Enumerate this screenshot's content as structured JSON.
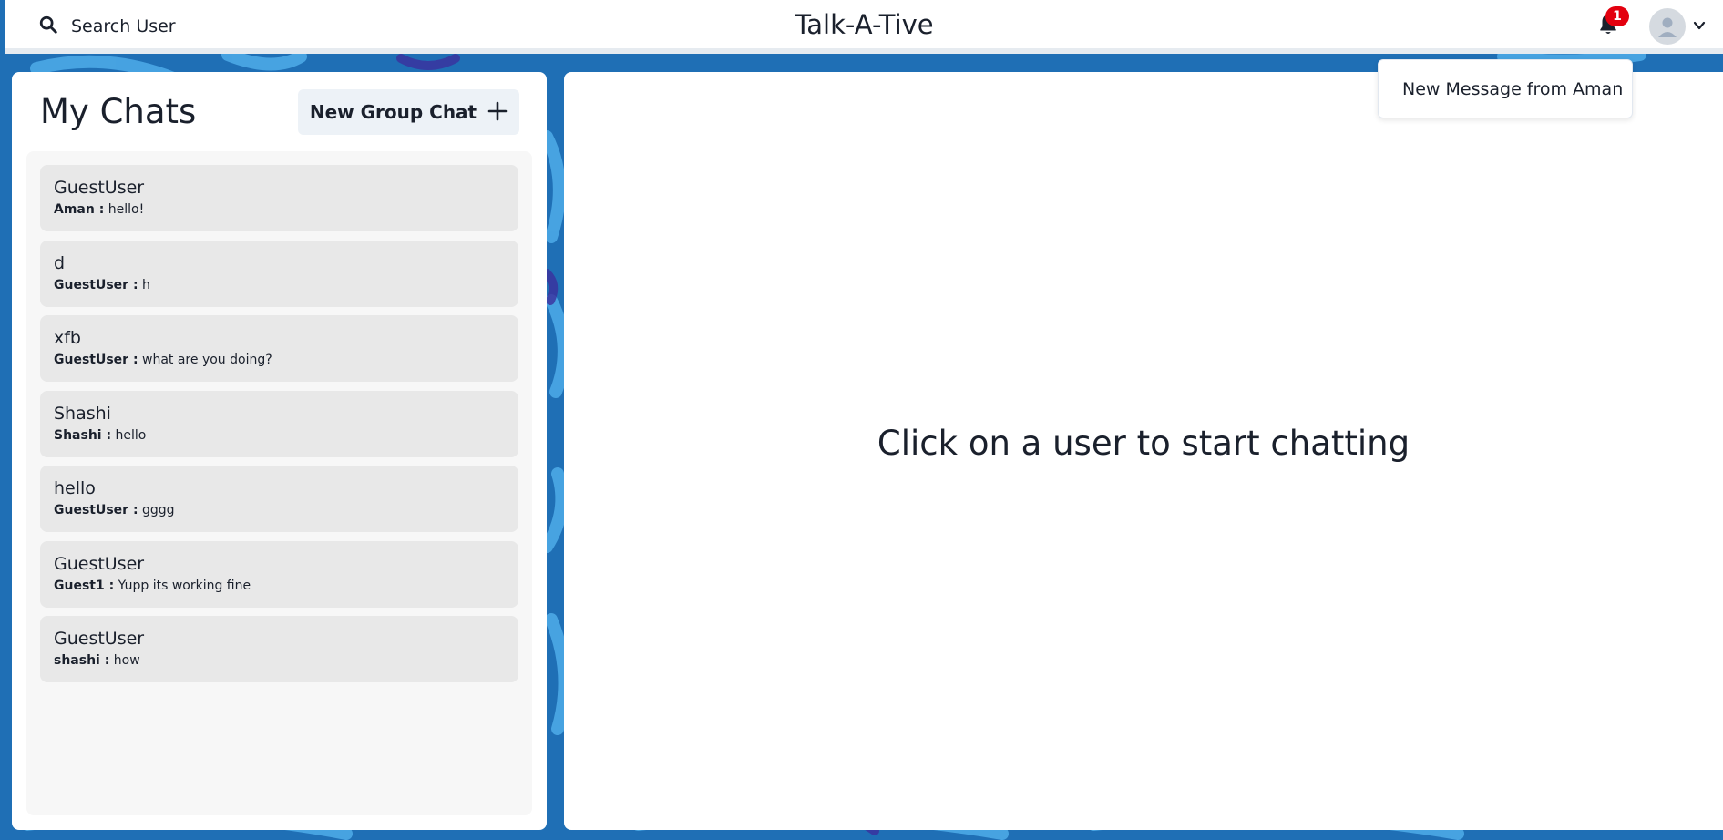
{
  "header": {
    "search_label": "Search User",
    "app_title": "Talk-A-Tive",
    "notification_count": "1",
    "icons": {
      "search": "search-icon",
      "bell": "bell-icon",
      "avatar": "user-avatar-icon",
      "chevron": "chevron-down-icon"
    }
  },
  "notifications": {
    "items": [
      {
        "label": "New Message from Aman"
      }
    ]
  },
  "my_chats": {
    "title": "My Chats",
    "new_group_label": "New Group Chat",
    "chats": [
      {
        "name": "GuestUser",
        "sender": "Aman :",
        "message": "hello!"
      },
      {
        "name": "d",
        "sender": "GuestUser :",
        "message": "h"
      },
      {
        "name": "xfb",
        "sender": "GuestUser :",
        "message": "what are you doing?"
      },
      {
        "name": "Shashi",
        "sender": "Shashi :",
        "message": "hello"
      },
      {
        "name": "hello",
        "sender": "GuestUser :",
        "message": "gggg"
      },
      {
        "name": "GuestUser",
        "sender": "Guest1 :",
        "message": "Yupp its working fine"
      },
      {
        "name": "GuestUser",
        "sender": "shashi :",
        "message": "how"
      }
    ]
  },
  "chat_box": {
    "placeholder": "Click on a user to start chatting"
  },
  "colors": {
    "background": "#1f6fb5",
    "badge": "#e3000f",
    "chat_item": "#e8e8e8",
    "button": "#edf2f7"
  }
}
